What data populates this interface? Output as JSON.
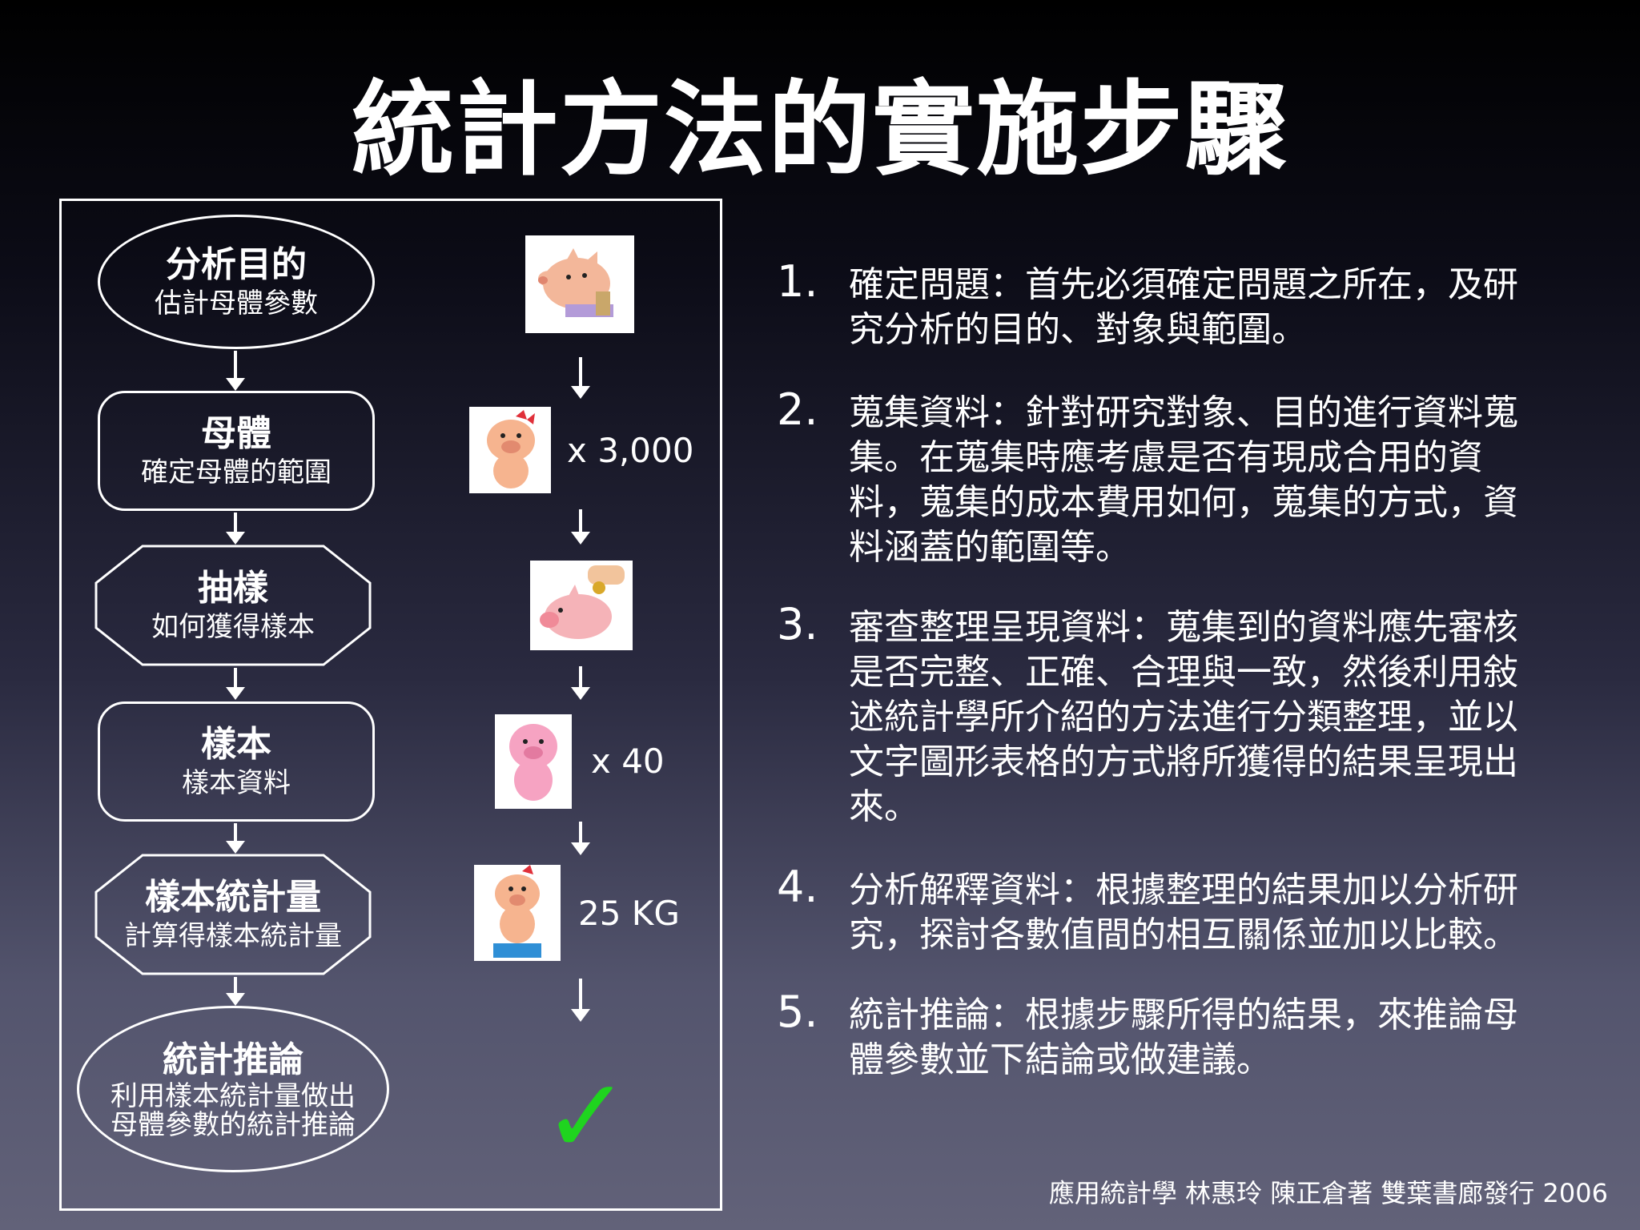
{
  "title": "統計方法的實施步驟",
  "flow": [
    {
      "title": "分析目的",
      "sub": "估計母體參數"
    },
    {
      "title": "母體",
      "sub": "確定母體的範圍"
    },
    {
      "title": "抽樣",
      "sub": "如何獲得樣本"
    },
    {
      "title": "樣本",
      "sub": "樣本資料"
    },
    {
      "title": "樣本統計量",
      "sub": "計算得樣本統計量"
    },
    {
      "title": "統計推論",
      "sub": "利用樣本統計量做出",
      "sub2": "母體參數的統計推論"
    }
  ],
  "counts": {
    "population": "x 3,000",
    "sample": "x 40",
    "weight": "25 KG"
  },
  "steps": [
    {
      "num": "1.",
      "line1": "確定問題：首先必須確定問題之所在，及研",
      "line2": "究分析的目的、對象與範圍。"
    },
    {
      "num": "2.",
      "line1": "蒐集資料：針對研究對象、目的進行資料蒐",
      "line2": "集。在蒐集時應考慮是否有現成合用的資",
      "line3": "料，蒐集的成本費用如何，蒐集的方式，資",
      "line4": "料涵蓋的範圍等。"
    },
    {
      "num": "3.",
      "line1": "審查整理呈現資料：蒐集到的資料應先審核",
      "line2": "是否完整、正確、合理與一致，然後利用敍",
      "line3": "述統計學所介紹的方法進行分類整理，並以",
      "line4": "文字圖形表格的方式將所獲得的結果呈現出",
      "line5": "來。"
    },
    {
      "num": "4.",
      "line1": "分析解釋資料：根據整理的結果加以分析研",
      "line2": "究，探討各數值間的相互關係並加以比較。"
    },
    {
      "num": "5.",
      "line1": "統計推論：根據步驟所得的結果，來推論母",
      "line2": "體參數並下結論或做建議。"
    }
  ],
  "footer": "應用統計學  林惠玲 陳正倉著  雙葉書廊發行 2006",
  "colors": {
    "check": "#1fd41f",
    "pig": "#f4a7b4"
  }
}
